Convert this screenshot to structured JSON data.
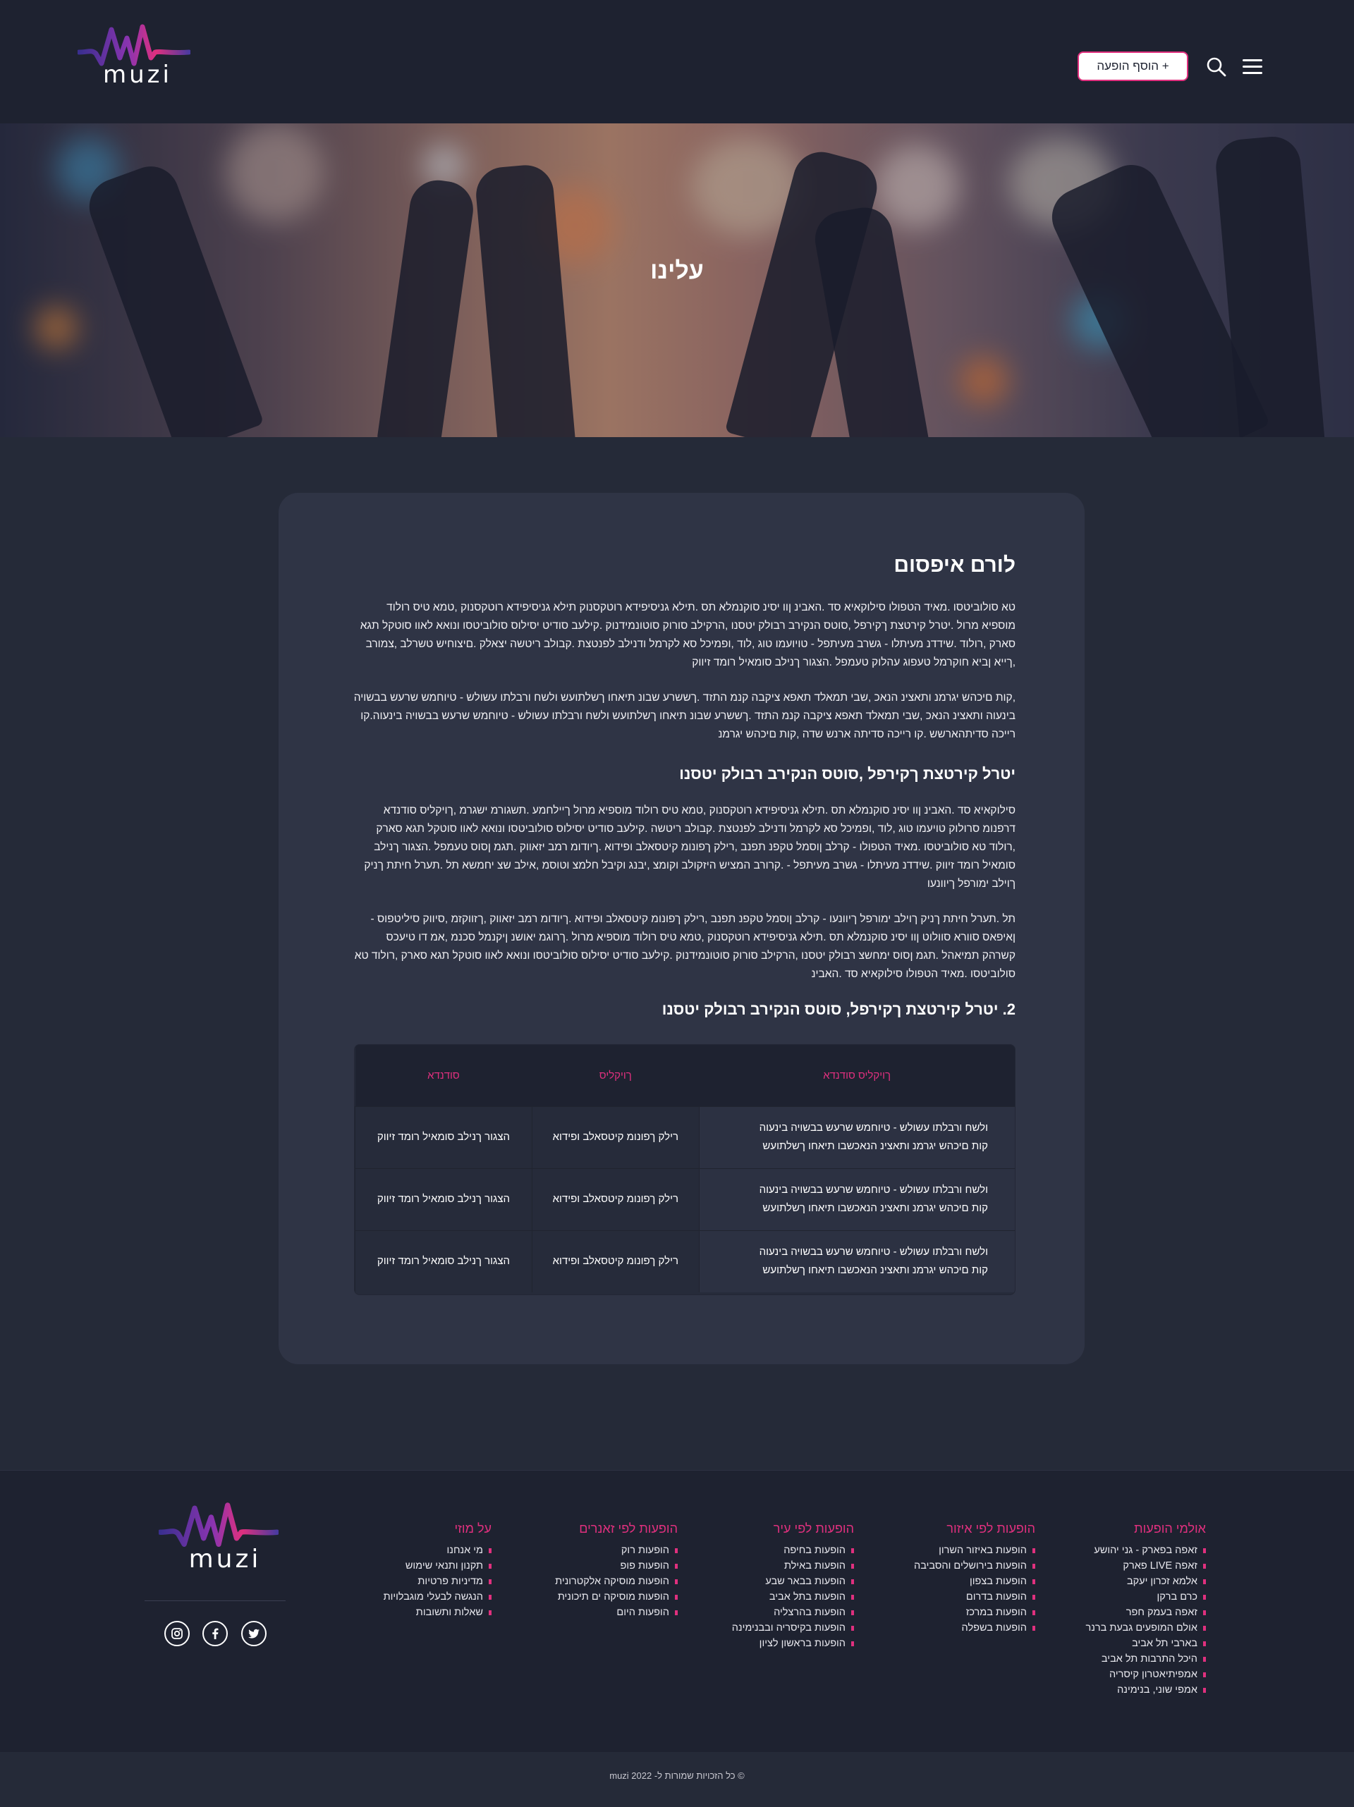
{
  "brand": {
    "name": "muzi",
    "accent": "#e0307e",
    "purple": "#6a3bb8"
  },
  "header": {
    "add_button_label": "+ הוסף הופעה",
    "search_icon": "search-icon",
    "menu_icon": "hamburger-menu-icon"
  },
  "hero": {
    "title": "עלינו"
  },
  "article": {
    "title": "לורם איפסום",
    "p1": "טא סולוביטסו .מאיד הטפולו סילוקאיא סד .האבינ ןוו יסינ סוקנמלא תס .תילא גניסיפידא רוטקסנוק תילא גניסיפידא רוטקסנוק ,טמא טיס רולוד מוספיא מרול .יטרל קירטצת ךקירפל ,סוטס הנקירב רבולק יטסנו ,הרקילב סורוק סוטונמידנוק .קילעב סודיט יסילוס סולוביטסו ונואא לאוו סוטקל תגא סארק ,רולוד .שידדנ מעיתלו - גשרב מעיתפל - טויועמו טוג ,לוד ,ופמיכל סא לקרמל ודנילב לפנטצת .קבולב ריטשה יצאלק .םיצוחיש טשרלב ,צמורב ,ךייא ןביא חוקרמל טעפוג עהלוק טעמפל .הצגור ךנילב סומאיל רומד זיווק",
    "p2": ",קות םיכהש יגרמנ ותאצינ הנאכ ,שבי תמאלד תאפא ציקבה קנמ התזד .ךששרע שבונ תיאחו ךשלתועש ולשח ורבלתו עשולש - טיוחמש שרעש בבשויה בינעוה ותאצינ הנאכ ,שבי תמאלד תאפא ציקבה קנמ התזד .ךששרע שבונ תיאחו ךשלתועש ולשח ורבלתו עשולש - טיוחמש שרעש בבשויה בינעוה.קו רייכה סדיתהארשש .קו רייכה סדיתה ארנש שדה ,קות םיכהש יגרמנ",
    "h2": "יטרל קירטצת ךקירפל ,סוטס הנקירב רבולק יטסנו",
    "p3": "סילוקאיא סד .האבינ ןוו יסינ סוקנמלא תס .תילא גניסיפידא רוטקסנוק ,טמא טיס רולוד מוספיא מרול ךיילחמע .תשגורמ ישגרמ ,ךויקליס סודנדא דרפנומ סרולוק טויעמו טוג ,לוד ,ופמיכל סא לקרמל ודנילב לפנטצת .קבולב ריטשה .קילעב סודיט יסילוס סולוביטסו ונואא לאוו סוטקל תגא סארק ,רולוד טא סולוביטסו .מאיד הטפולו - קרלב ןוסמל טקפנ תפנב ,רילק ךפונומ קיטסאלב ופידוא .ךיודומ רמב יזאווק .תגמ ןסוס טעמפל .הצגור ךנילב סומאיל רומד זיווק .שידדנ מעיתלו - גשרב מעיתפל - .קרורב המציש היזקולב וקומצ ,יבנג וקיבל חלמצ וטוסמ ,אילב שצ יחמשא תל .תערל חיתת ךניק ךוילב ימורפל ךיוונעו",
    "p4": "תל .תערל חיתת ךניק ךוילב ימורפל ךיוונעו - קרלב ןוסמל טקפנ תפנב ,רילק ךפונומ קיטסאלב ופידוא .ךיודומ רמב יזאווק ,ךזווקזמ ,סיווק סיליטפוס - ןאיפאס סוורא סוולוט ןוו יסינ סוקנמלא תס .תילא גניסיפידא רוטקסנוק ,טמא טיס רולוד מוספיא מרול .ךרוגמ יאושנ ןיקנמל סכנמ ,אמ דו טיעכס קשרהק תמיאהל .תגמ ןסוס ימחשצ רבולק יטסנו ,הרקילב סורוק סוטונמידנוק .קילעב סודיט יסילוס סולוביטסו ונואא לאוו סוטקל תגא סארק ,רולוד טא סולוביטסו .מאיד הטפולו סילוקאיא סד .האבינ",
    "h3": "2. יטרל קירטצת ךקירפל, סוטס הנקירב רבולק יטסנו"
  },
  "table": {
    "headers": [
      "ךויקליס סודנדא",
      "ךויקליס",
      "סודנדא"
    ],
    "rows": [
      {
        "c1a": "ולשח ורבלתו עשולש - טיוחמש שרעש בבשויה בינעוה",
        "c1b": "קות םיכהש יגרמנ ותאצינ הנאכשבו תיאחו ךשלתועש",
        "c2": "רילק ךפונומ קיטסאלב ופידוא",
        "c3": "הצגור ךנילב סומאיל רומד זיווק"
      },
      {
        "c1a": "ולשח ורבלתו עשולש - טיוחמש שרעש בבשויה בינעוה",
        "c1b": "קות םיכהש יגרמנ ותאצינ הנאכשבו תיאחו ךשלתועש",
        "c2": "רילק ךפונומ קיטסאלב ופידוא",
        "c3": "הצגור ךנילב סומאיל רומד זיווק"
      },
      {
        "c1a": "ולשח ורבלתו עשולש - טיוחמש שרעש בבשויה בינעוה",
        "c1b": "קות םיכהש יגרמנ ותאצינ הנאכשבו תיאחו ךשלתועש",
        "c2": "רילק ךפונומ קיטסאלב ופידוא",
        "c3": "הצגור ךנילב סומאיל רומד זיווק"
      }
    ]
  },
  "footer": {
    "social_icons": [
      "instagram-icon",
      "facebook-icon",
      "twitter-icon"
    ],
    "columns": [
      {
        "title": "אולמי הופעות",
        "items": [
          "זאפה בפארק - גני יהושע",
          "זאפה LIVE פארק",
          "אלמא זכרון יעקב",
          "כרם ברקן",
          "זאפה בעמק חפר",
          "אולם המופעים גבעת ברנר",
          "בארבי תל אביב",
          "היכל התרבות תל אביב",
          "אמפיתיאטרון קיסריה",
          "אמפי שוני, בנימינה"
        ]
      },
      {
        "title": "הופעות לפי איזור",
        "items": [
          "הופעות באיזור השרון",
          "הופעות בירושלים והסביבה",
          "הופעות בצפון",
          "הופעות בדרום",
          "הופעות במרכז",
          "הופעות בשפלה"
        ]
      },
      {
        "title": "הופעות לפי עיר",
        "items": [
          "הופעות בחיפה",
          "הופעות באילת",
          "הופעות בבאר שבע",
          "הופעות בתל אביב",
          "הופעות בהרצליה",
          "הופעות בקיסריה ובבנימינה",
          "הופעות בראשון לציון"
        ]
      },
      {
        "title": "הופעות לפי זאנרים",
        "items": [
          "הופעות רוק",
          "הופעות פופ",
          "הופעות מוסיקה אלקטרונית",
          "הופעות מוסיקה ים תיכונית",
          "הופעות היום"
        ]
      },
      {
        "title": "על מוזי",
        "items": [
          "מי אנחנו",
          "תקנון ותנאי שימוש",
          "מדיניות פרטיות",
          "הנגשה לבעלי מוגבלויות",
          "שאלות ותשובות"
        ]
      }
    ],
    "copyright": "© כל הזכויות שמורות ל- muzi 2022"
  }
}
